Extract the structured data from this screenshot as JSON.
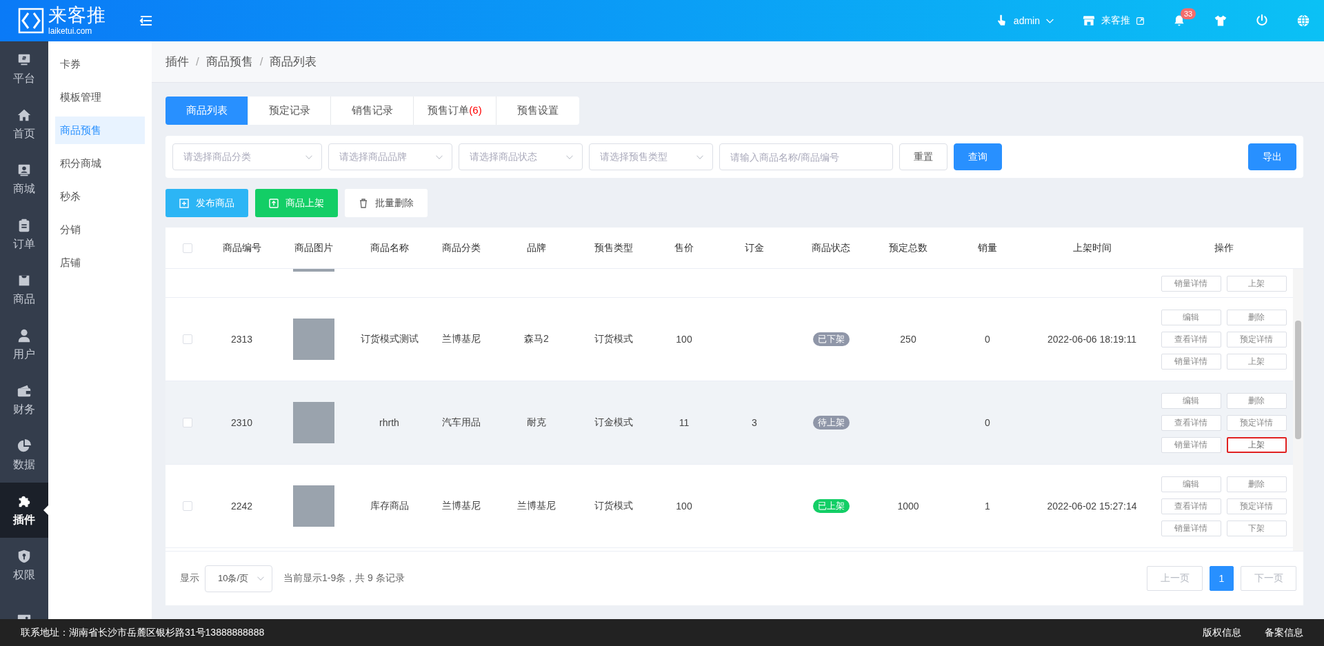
{
  "header": {
    "logo_text": "来客推",
    "logo_domain": "laiketui.com",
    "user": "admin",
    "store": "来客推",
    "notifications": "33"
  },
  "rail": [
    {
      "label": "平台",
      "selected": false
    },
    {
      "label": "首页",
      "selected": false
    },
    {
      "label": "商城",
      "selected": false
    },
    {
      "label": "订单",
      "selected": false
    },
    {
      "label": "商品",
      "selected": false
    },
    {
      "label": "用户",
      "selected": false
    },
    {
      "label": "财务",
      "selected": false
    },
    {
      "label": "数据",
      "selected": false
    },
    {
      "label": "插件",
      "selected": true
    },
    {
      "label": "权限",
      "selected": false
    },
    {
      "selected": false
    }
  ],
  "submenu": [
    {
      "label": "卡券",
      "selected": false
    },
    {
      "label": "模板管理",
      "selected": false
    },
    {
      "label": "商品预售",
      "selected": true
    },
    {
      "label": "积分商城",
      "selected": false
    },
    {
      "label": "秒杀",
      "selected": false
    },
    {
      "label": "分销",
      "selected": false
    },
    {
      "label": "店铺",
      "selected": false
    }
  ],
  "breadcrumb": {
    "items": [
      "插件",
      "商品预售",
      "商品列表"
    ],
    "separator": "/"
  },
  "tabs": [
    {
      "label": "商品列表",
      "selected": true
    },
    {
      "label": "预定记录",
      "selected": false
    },
    {
      "label": "销售记录",
      "selected": false
    },
    {
      "label": "预售订单",
      "count": "(6)",
      "selected": false
    },
    {
      "label": "预售设置",
      "selected": false
    }
  ],
  "filters": {
    "selects": [
      {
        "placeholder": "请选择商品分类"
      },
      {
        "placeholder": "请选择商品品牌"
      },
      {
        "placeholder": "请选择商品状态"
      },
      {
        "placeholder": "请选择预售类型"
      }
    ],
    "search": {
      "placeholder": "请输入商品名称/商品编号"
    },
    "buttons": [
      {
        "label": "重置",
        "kind": "plain"
      },
      {
        "label": "查询",
        "kind": "primary"
      }
    ],
    "export": "导出"
  },
  "actions": [
    {
      "label": "发布商品",
      "kind": "info"
    },
    {
      "label": "商品上架",
      "kind": "success"
    },
    {
      "label": "批量删除",
      "kind": "plain"
    }
  ],
  "table": {
    "select_all": {
      "checked": false
    },
    "columns": [
      "商品编号",
      "商品图片",
      "商品名称",
      "商品分类",
      "品牌",
      "预售类型",
      "售价",
      "订金",
      "商品状态",
      "预定总数",
      "销量",
      "上架时间",
      "操作"
    ],
    "clipped_row": {
      "actions": [
        {
          "label": "销量详情",
          "outlined": false
        },
        {
          "label": "上架",
          "outlined": false
        }
      ]
    },
    "rows": [
      {
        "checked": false,
        "highlighted": false,
        "id": "2313",
        "name": "订货模式测试",
        "category": "兰博基尼",
        "brand": "森马2",
        "presale_type": "订货模式",
        "price": "100",
        "status": {
          "label": "已下架",
          "color": "#8f96a8"
        },
        "reserved_total": "250",
        "sales": "0",
        "listed_time": "2022-06-06 18:19:11",
        "actions": [
          {
            "label": "编辑",
            "outlined": false
          },
          {
            "label": "删除",
            "outlined": false
          },
          {
            "label": "查看详情",
            "outlined": false
          },
          {
            "label": "预定详情",
            "outlined": false
          },
          {
            "label": "销量详情",
            "outlined": false
          },
          {
            "label": "上架",
            "outlined": false
          }
        ]
      },
      {
        "checked": false,
        "highlighted": true,
        "id": "2310",
        "name": "rhrth",
        "category": "汽车用品",
        "brand": "耐克",
        "presale_type": "订金模式",
        "price": "11",
        "deposit": "3",
        "status": {
          "label": "待上架",
          "color": "#8f96a8"
        },
        "sales": "0",
        "actions": [
          {
            "label": "编辑",
            "outlined": false
          },
          {
            "label": "删除",
            "outlined": false
          },
          {
            "label": "查看详情",
            "outlined": false
          },
          {
            "label": "预定详情",
            "outlined": false
          },
          {
            "label": "销量详情",
            "outlined": false
          },
          {
            "label": "上架",
            "outlined": true
          }
        ]
      },
      {
        "checked": false,
        "highlighted": false,
        "id": "2242",
        "name": "库存商品",
        "category": "兰博基尼",
        "brand": "兰博基尼",
        "presale_type": "订货模式",
        "price": "100",
        "status": {
          "label": "已上架",
          "color": "#13ce66"
        },
        "reserved_total": "1000",
        "sales": "1",
        "listed_time": "2022-06-02 15:27:14",
        "actions": [
          {
            "label": "编辑",
            "outlined": false
          },
          {
            "label": "删除",
            "outlined": false
          },
          {
            "label": "查看详情",
            "outlined": false
          },
          {
            "label": "预定详情",
            "outlined": false
          },
          {
            "label": "销量详情",
            "outlined": false
          },
          {
            "label": "下架",
            "outlined": false
          }
        ]
      }
    ]
  },
  "pagination": {
    "show_label": "显示",
    "page_size": "10条/页",
    "summary": "当前显示1-9条，共 9 条记录",
    "prev": {
      "label": "上一页",
      "disabled": true
    },
    "pages": [
      {
        "label": "1",
        "selected": true
      }
    ],
    "next": {
      "label": "下一页",
      "disabled": true
    }
  },
  "footer": {
    "address": "联系地址：湖南省长沙市岳麓区银杉路31号13888888888",
    "links": [
      "版权信息",
      "备案信息"
    ]
  }
}
